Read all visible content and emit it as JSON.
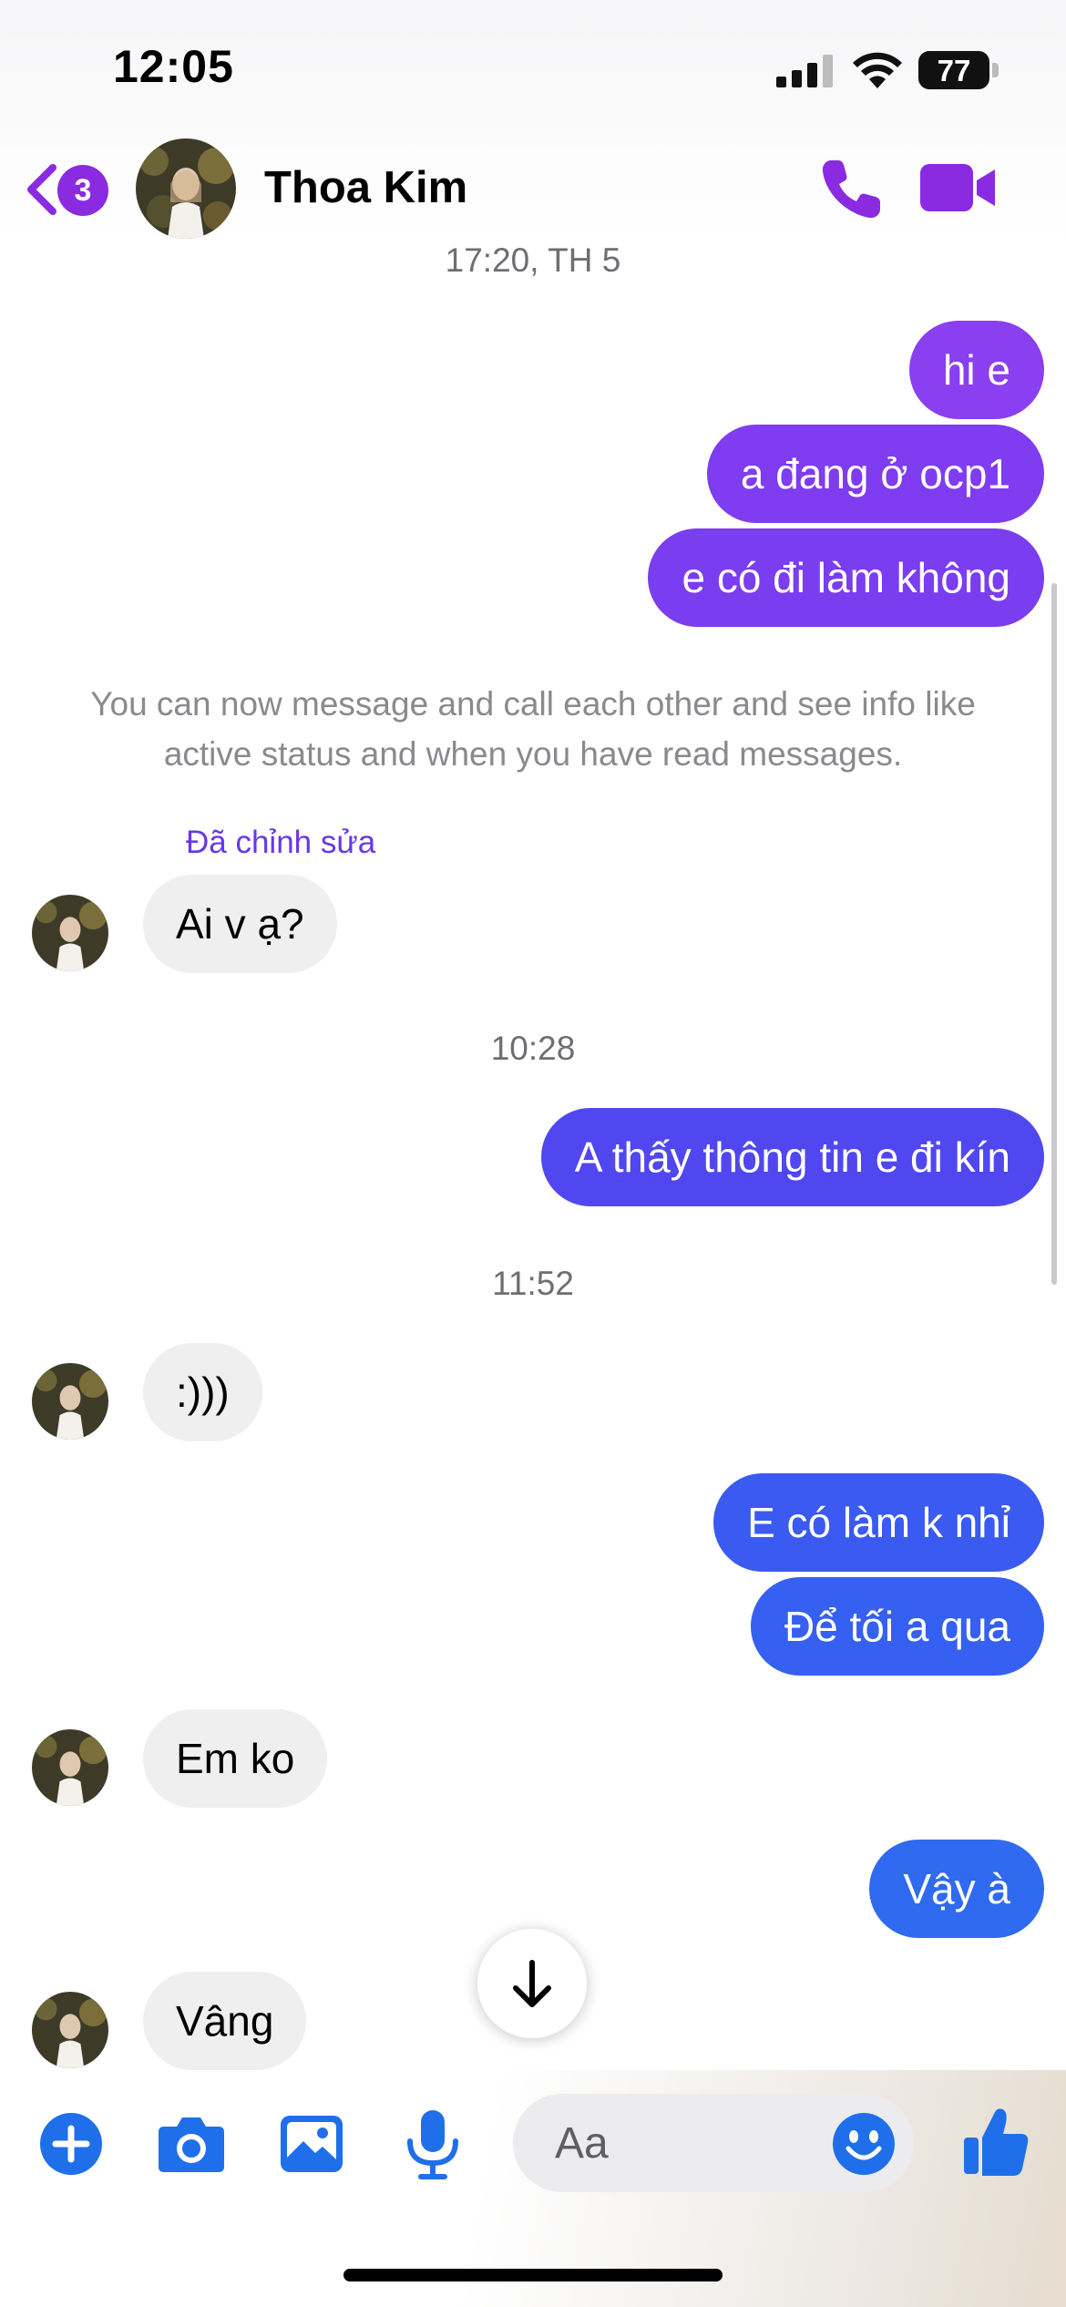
{
  "status_bar": {
    "time": "12:05",
    "battery": "77"
  },
  "header": {
    "back_badge": "3",
    "contact_name": "Thoa Kim"
  },
  "colors": {
    "accent_purple": "#8a2be2",
    "out_purple": "#7f3cf0",
    "out_blue": "#3a5cf2",
    "out_blue2": "#2f6af0"
  },
  "conversation": {
    "timestamp_1": "17:20, TH 5",
    "msg_1": "hi e",
    "msg_2": "a đang ở ocp1",
    "msg_3": "e có đi làm không",
    "info_text": "You can now message and call each other and see info like active status and when you have read messages.",
    "edited_label": "Đã chỉnh sửa",
    "msg_4": "Ai v ạ?",
    "timestamp_2": "10:28",
    "msg_5": "A thấy thông tin e đi kín",
    "timestamp_3": "11:52",
    "msg_6": ":)))",
    "msg_7": "E có làm k nhỉ",
    "msg_8": "Để tối a qua",
    "msg_9": "Em ko",
    "msg_10": "Vậy à",
    "msg_11": "Vâng"
  },
  "composer": {
    "placeholder": "Aa"
  },
  "icons": [
    "back-chevron-icon",
    "phone-icon",
    "video-camera-icon",
    "arrow-down-icon",
    "plus-icon",
    "camera-icon",
    "gallery-icon",
    "microphone-icon",
    "emoji-icon",
    "thumbs-up-icon"
  ]
}
